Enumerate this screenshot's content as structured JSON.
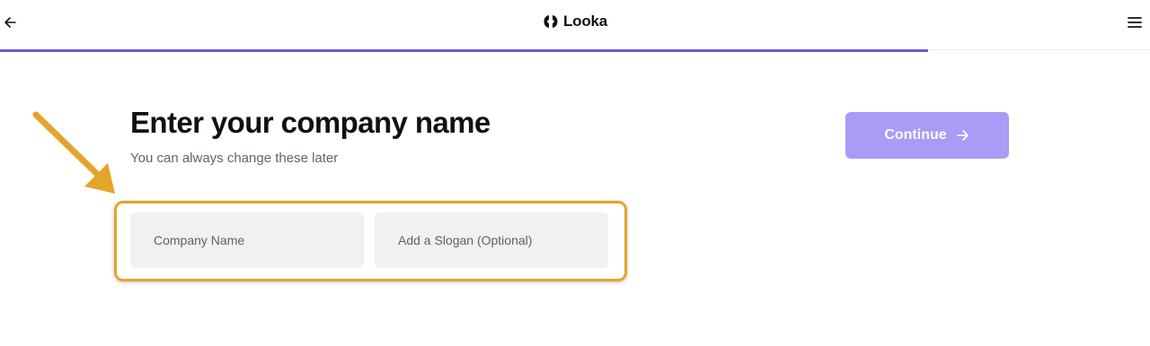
{
  "header": {
    "brand_name": "Looka",
    "back_icon": "arrow-left-icon",
    "menu_icon": "hamburger-menu-icon",
    "logo_icon": "looka-logo-icon",
    "progress_fraction": 0.807,
    "progress_color": "#6a5ad6"
  },
  "main": {
    "title": "Enter your company name",
    "subtitle": "You can always change these later",
    "continue_label": "Continue",
    "continue_icon": "arrow-right-icon",
    "continue_color": "#a99bf6",
    "company_name_placeholder": "Company Name",
    "company_name_value": "",
    "slogan_placeholder": "Add a Slogan (Optional)",
    "slogan_value": ""
  },
  "annotation": {
    "color": "#e3a52c",
    "arrow_icon": "annotation-arrow-icon"
  }
}
